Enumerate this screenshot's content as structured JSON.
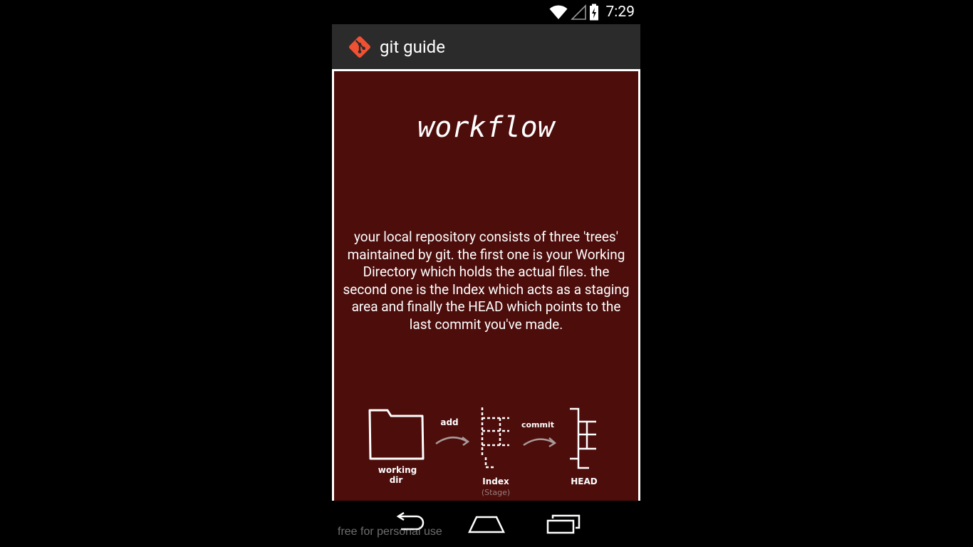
{
  "status_bar": {
    "time": "7:29",
    "icons": [
      "wifi-icon",
      "signal-icon",
      "battery-charging-icon"
    ]
  },
  "action_bar": {
    "icon": "git-logo-icon",
    "title": "git guide",
    "logo_color": "#f05133"
  },
  "slide": {
    "title": "workflow",
    "body": "your local repository consists of three 'trees' maintained by git. the first one is your Working Directory which holds the actual files. the second one is the Index which acts as a staging area and finally the HEAD which points to the last commit you've made.",
    "background_color": "#4c0d0b",
    "diagram": {
      "working_dir_label_1": "working",
      "working_dir_label_2": "dir",
      "add_label": "add",
      "index_label": "Index",
      "index_sublabel": "(Stage)",
      "commit_label": "commit",
      "head_label": "HEAD"
    }
  },
  "nav_bar": {
    "buttons": [
      "back-icon",
      "home-icon",
      "recents-icon"
    ]
  },
  "watermark": "free for personal use"
}
